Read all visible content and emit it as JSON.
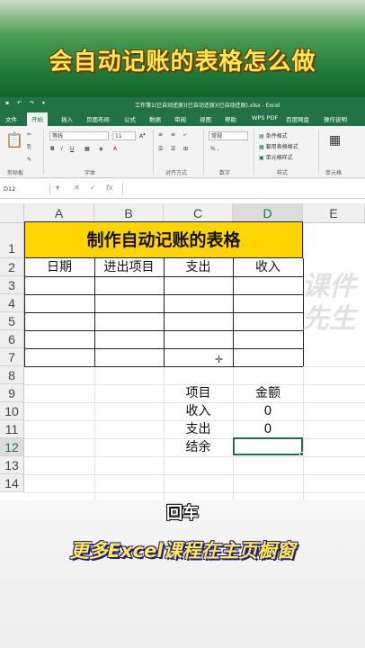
{
  "banner": {
    "title": "会自动记账的表格怎么做"
  },
  "window": {
    "title": "工作簿1(已自动还原)(已自动还原)(已自动还原).xlsx - Excel",
    "qa_icons": [
      "save-icon",
      "undo-icon",
      "redo-icon",
      "more-icon"
    ]
  },
  "tabs": [
    {
      "label": "文件"
    },
    {
      "label": "开始"
    },
    {
      "label": "插入"
    },
    {
      "label": "页面布局"
    },
    {
      "label": "公式"
    },
    {
      "label": "数据"
    },
    {
      "label": "审阅"
    },
    {
      "label": "视图"
    },
    {
      "label": "帮助"
    },
    {
      "label": "WPS PDF"
    },
    {
      "label": "百度网盘"
    },
    {
      "label": "操作说明"
    }
  ],
  "ribbon": {
    "font_name": "等线",
    "font_size": "11",
    "number_format": "常规",
    "cond_format": "条件格式",
    "table_format": "套用表格格式",
    "cell_style": "单元格样式",
    "groups": {
      "clipboard": "剪贴板",
      "font": "字体",
      "align": "对齐方式",
      "number": "数字",
      "styles": "样式",
      "cells": "单元格"
    }
  },
  "formula_bar": {
    "name_box": "D12",
    "value": ""
  },
  "columns": [
    "A",
    "B",
    "C",
    "D",
    "E"
  ],
  "selected_column": "D",
  "rows": [
    "1",
    "2",
    "3",
    "4",
    "5",
    "6",
    "7",
    "8",
    "9",
    "10",
    "11",
    "12",
    "13",
    "14"
  ],
  "selected_row": "12",
  "sheet": {
    "title": "制作自动记账的表格",
    "headers": [
      "日期",
      "进出项目",
      "支出",
      "收入"
    ],
    "summary": [
      {
        "label": "项目",
        "value": "金额"
      },
      {
        "label": "收入",
        "value": "0"
      },
      {
        "label": "支出",
        "value": "0"
      },
      {
        "label": "结余",
        "value": ""
      }
    ]
  },
  "watermark": "课件\n先生",
  "overlay": {
    "key_hint": "回车",
    "caption": "更多Excel课程在主页橱窗"
  },
  "colors": {
    "excel_green": "#217346",
    "title_fill": "#ffd400",
    "banner_text": "#ffe94d"
  }
}
